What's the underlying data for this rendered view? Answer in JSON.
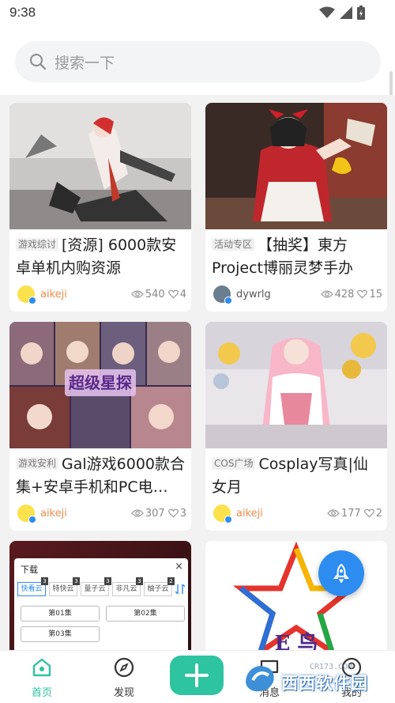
{
  "status": {
    "time": "9:38"
  },
  "search": {
    "placeholder": "搜索一下"
  },
  "cards": [
    {
      "tag": "游戏综讨",
      "title": "[资源] 6000款安卓单机内购资源",
      "author": "aikeji",
      "views": "540",
      "likes": "4"
    },
    {
      "tag": "活动专区",
      "title": "【抽奖】東方Project博丽灵梦手办",
      "author": "dywrlg",
      "views": "428",
      "likes": "15"
    },
    {
      "tag": "游戏安利",
      "title": "Gal游戏6000款合集+安卓手机和PC电…",
      "author": "aikeji",
      "views": "307",
      "likes": "3"
    },
    {
      "tag": "COS广场",
      "title": "Cosplay写真|仙女月",
      "author": "aikeji",
      "views": "177",
      "likes": "2"
    }
  ],
  "overlay_card": {
    "title": "下载",
    "close": "×",
    "sources": [
      "快看云",
      "特快云",
      "量子云",
      "非凡云",
      "柚子云"
    ],
    "source_badges": [
      "3",
      "3",
      "3",
      "3",
      "2"
    ],
    "episodes": [
      "第01集",
      "第02集",
      "第03集"
    ]
  },
  "logo_card": {
    "text": "E 鸟"
  },
  "nav": {
    "home": "首页",
    "discover": "发现",
    "messages": "消息",
    "mine": "我的"
  },
  "watermark": {
    "text": "西西软件园",
    "sub": "CR173.COM"
  },
  "colors": {
    "accent": "#2ec4a0",
    "author_orange": "#f08c4a",
    "fab_blue": "#2d8cf0"
  }
}
